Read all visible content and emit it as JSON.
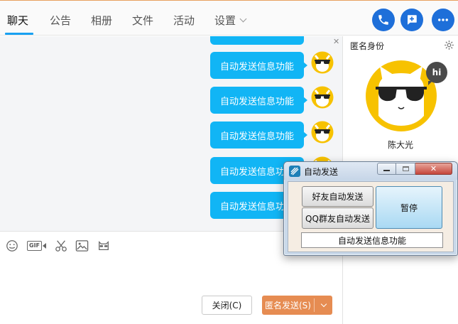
{
  "tabs": [
    "聊天",
    "公告",
    "相册",
    "文件",
    "活动",
    "设置"
  ],
  "chat": {
    "messages": [
      "自动发送信息功能",
      "自动发送信息功能",
      "自动发送信息功能",
      "自动发送信息功能",
      "自动发送信息功能",
      "自动发送信息功能"
    ]
  },
  "toolbar": {
    "gif_label": "GIF"
  },
  "buttons": {
    "close": "关闭(C)",
    "send": "匿名发送(S)"
  },
  "right_panel": {
    "title": "匿名身份",
    "hi": "hi",
    "name": "陈大光"
  },
  "popup": {
    "title": "自动发送",
    "friend_send": "好友自动发送",
    "group_send": "QQ群友自动发送",
    "pause": "暂停",
    "field_value": "自动发送信息功能"
  },
  "colors": {
    "bubble": "#11b5f5",
    "accent_blue": "#1e6fd9",
    "send_button": "#e68c52",
    "avatar_yellow": "#f7c200"
  }
}
